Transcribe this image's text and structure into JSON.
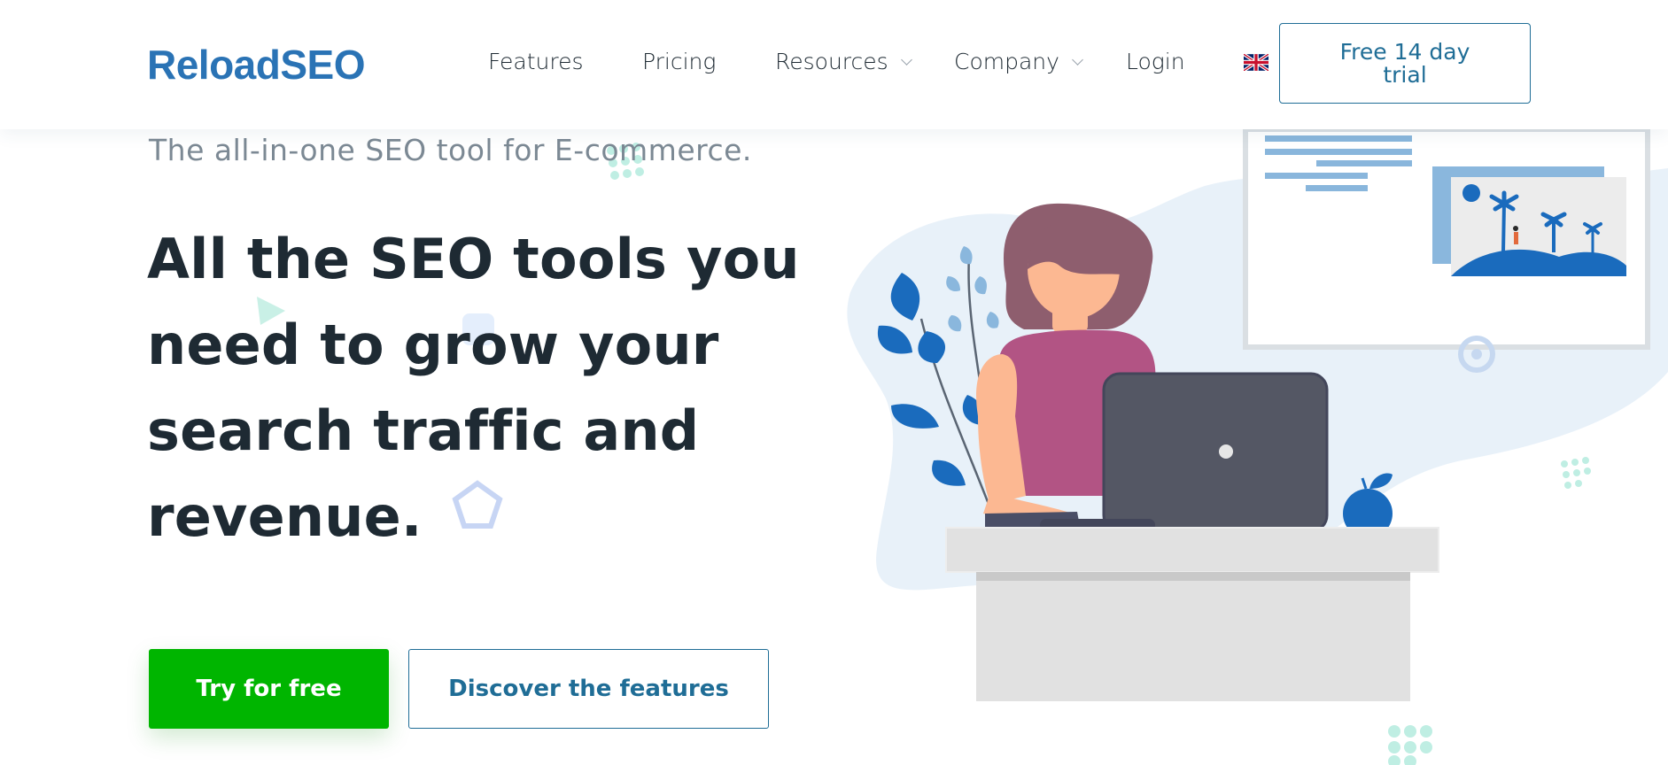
{
  "header": {
    "logo": "ReloadSEO",
    "nav": [
      {
        "label": "Features",
        "dropdown": false
      },
      {
        "label": "Pricing",
        "dropdown": false
      },
      {
        "label": "Resources",
        "dropdown": true
      },
      {
        "label": "Company",
        "dropdown": true
      },
      {
        "label": "Login",
        "dropdown": false
      }
    ],
    "language_icon": "uk-flag-icon",
    "trial_button": "Free 14 day trial"
  },
  "hero": {
    "subtitle": "The all-in-one SEO tool for E-commerce.",
    "headline": "All the SEO tools you need to grow your search traffic and revenue.",
    "primary_button": "Try for free",
    "secondary_button": "Discover the features"
  },
  "colors": {
    "brand_blue": "#2a73b5",
    "button_outline": "#1f6d96",
    "primary_green": "#00b500",
    "headline": "#1e2a33",
    "subtitle": "#7c8994"
  }
}
